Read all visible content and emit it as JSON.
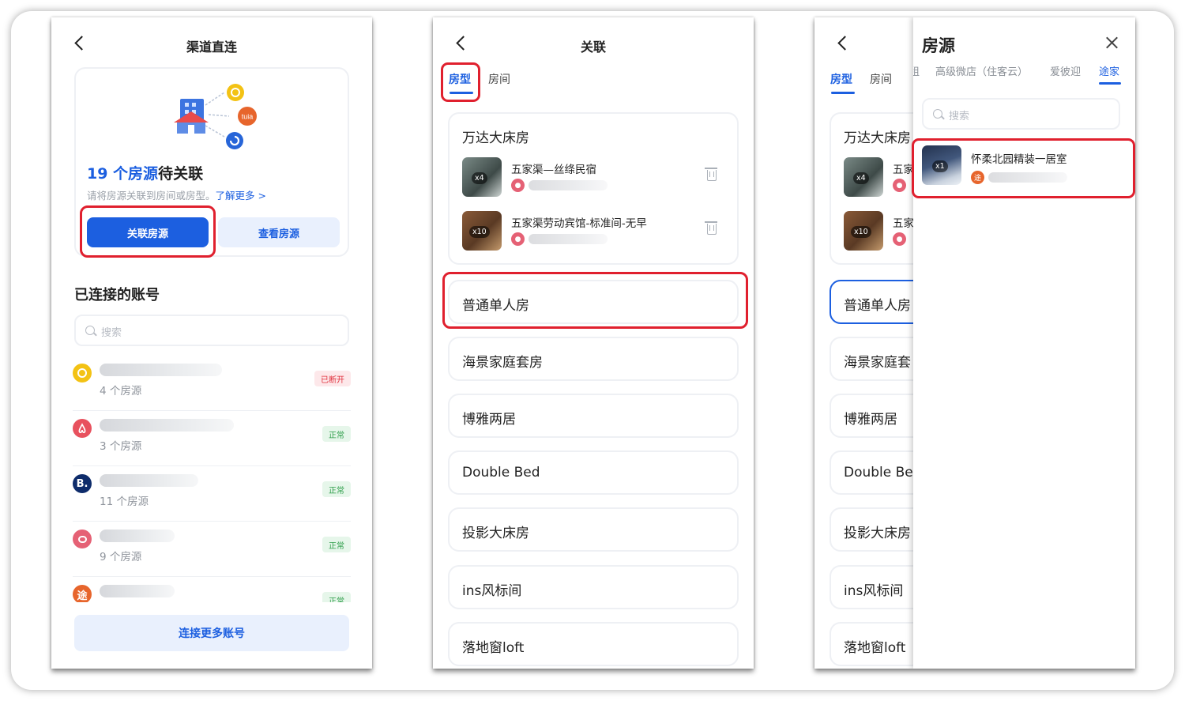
{
  "screen1": {
    "title": "渠道直连",
    "pending_count": "19 个房源",
    "pending_suffix": "待关联",
    "hint": "请将房源关联到房间或房型。",
    "learn_more": "了解更多 >",
    "link_button": "关联房源",
    "view_button": "查看房源",
    "section_title": "已连接的账号",
    "search_placeholder": "搜索",
    "accounts": [
      {
        "count": "4 个房源",
        "status": "已断开",
        "logo": "yellow-ring-icon",
        "color": "#f3c214"
      },
      {
        "count": "3 个房源",
        "status": "正常",
        "logo": "airbnb-icon",
        "color": "#e8515e"
      },
      {
        "count": "11 个房源",
        "status": "正常",
        "logo": "booking-icon",
        "color": "#0e2c6b"
      },
      {
        "count": "9 个房源",
        "status": "正常",
        "logo": "pig-icon",
        "color": "#e56175"
      },
      {
        "count": "",
        "status": "正常",
        "logo": "tujia-icon",
        "color": "#e7652c"
      }
    ],
    "more_button": "连接更多账号",
    "logo_glyphs": {
      "tuia": "tuia",
      "booking": "B.",
      "tujia": "途"
    }
  },
  "screen2": {
    "title": "关联",
    "tabs": [
      "房型",
      "房间"
    ],
    "rooms": {
      "first": "万达大床房",
      "properties": [
        {
          "name": "五家渠—丝绦民宿",
          "count": "x4"
        },
        {
          "name": "五家渠劳动宾馆-标准间-无早",
          "count": "x10"
        }
      ],
      "others": [
        "普通单人房",
        "海景家庭套房",
        "博雅两居",
        "Double Bed",
        "投影大床房",
        "ins风标间",
        "落地窗loft"
      ]
    }
  },
  "screen3": {
    "tabs": [
      "房型",
      "房间"
    ],
    "rooms_visible": [
      "万达大床房",
      "普通单人房",
      "海景家庭套",
      "博雅两居",
      "Double Bec",
      "投影大床房",
      "ins风标间",
      "落地窗loft"
    ],
    "prop_prefix": [
      "五家",
      "五家"
    ],
    "prop_counts": [
      "x4",
      "x10"
    ],
    "drawer": {
      "title": "房源",
      "channel_tabs": [
        "租",
        "高级微店（住客云）",
        "爱彼迎",
        "途家"
      ],
      "search_placeholder": "搜索",
      "property": {
        "name": "怀柔北园精装一居室",
        "count": "x1",
        "channel_glyph": "途"
      }
    }
  }
}
